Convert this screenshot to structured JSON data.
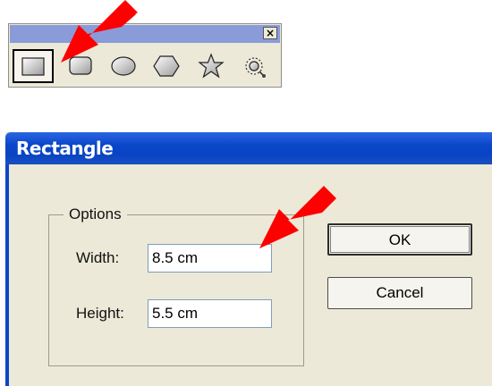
{
  "palette": {
    "close_label": "×",
    "tools": [
      {
        "name": "rectangle-tool",
        "icon": "rectangle-icon",
        "selected": true
      },
      {
        "name": "rounded-rectangle-tool",
        "icon": "rounded-rectangle-icon",
        "selected": false
      },
      {
        "name": "ellipse-tool",
        "icon": "ellipse-icon",
        "selected": false
      },
      {
        "name": "polygon-tool",
        "icon": "hexagon-icon",
        "selected": false
      },
      {
        "name": "star-tool",
        "icon": "star-icon",
        "selected": false
      },
      {
        "name": "flare-tool",
        "icon": "flare-icon",
        "selected": false
      }
    ],
    "title_color": "#8a9bd9"
  },
  "dialog": {
    "title": "Rectangle",
    "options_label": "Options",
    "width_label": "Width:",
    "width_value": "8.5 cm",
    "height_label": "Height:",
    "height_value": "5.5 cm",
    "ok_label": "OK",
    "cancel_label": "Cancel",
    "title_color": "#0a46c8",
    "background_color": "#ece9d8"
  },
  "annotations": {
    "arrow_color": "#ff0000",
    "arrows": [
      "arrow-to-rectangle-tool",
      "arrow-to-width-field"
    ]
  }
}
